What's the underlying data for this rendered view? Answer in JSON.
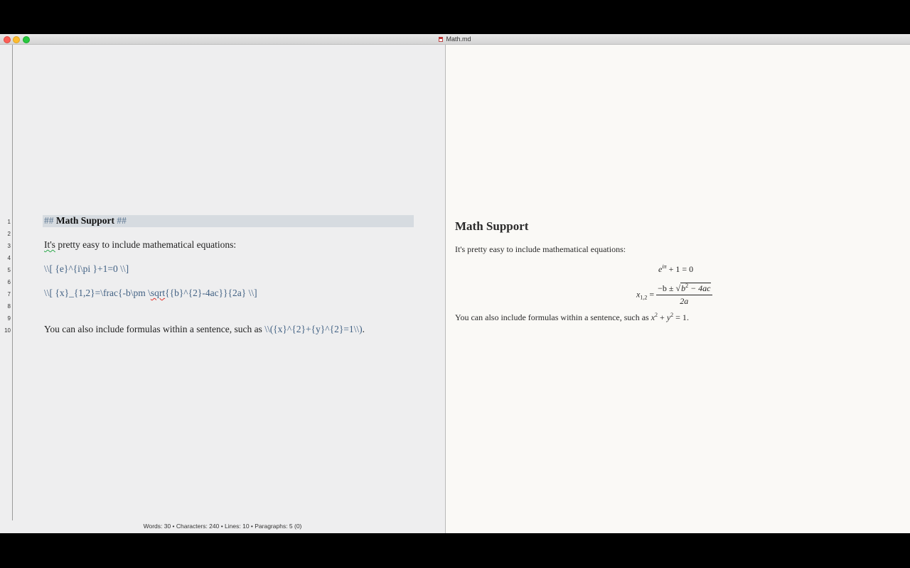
{
  "window": {
    "title": "Math.md"
  },
  "editor": {
    "line_numbers": [
      "1",
      "2",
      "3",
      "4",
      "5",
      "6",
      "7",
      "8",
      "9",
      "10"
    ],
    "heading_marker_open": "##",
    "heading_text": "Math Support",
    "heading_marker_close": "##",
    "line3_word": "It's",
    "line3_rest": " pretty easy to include mathematical equations:",
    "line5": "\\\\[ {e}^{i\\pi }+1=0 \\\\]",
    "line7_a": "\\\\[ {x}_{1,2}=\\frac{-b\\pm \\",
    "line7_b": "sqrt",
    "line7_c": "{{b}^{2}-4ac}}{2a} \\\\]",
    "line10_text": "You can also include formulas within a sentence, such as ",
    "line10_code": "\\\\({x}^{2}+{y}^{2}=1\\\\)",
    "line10_end": "."
  },
  "status_bar": {
    "text": "Words: 30 • Characters: 240 • Lines: 10 • Paragraphs: 5 (0)"
  },
  "preview": {
    "heading": "Math Support",
    "para1": "It's pretty easy to include mathematical equations:",
    "eq1": {
      "base": "e",
      "exp": "iπ",
      "rest": " + 1 = 0"
    },
    "eq2": {
      "lhs": "x",
      "sub": "1,2",
      "eq": " = ",
      "num_a": "−b ± ",
      "radical": "√",
      "num_b": "b",
      "num_b_exp": "2",
      "num_c": " − 4ac",
      "den": "2a"
    },
    "para2_text": "You can also include formulas within a sentence, such as ",
    "inline": {
      "x": "x",
      "x_exp": "2",
      "plus": " + ",
      "y": "y",
      "y_exp": "2",
      "eq": " = 1",
      "end": "."
    }
  }
}
